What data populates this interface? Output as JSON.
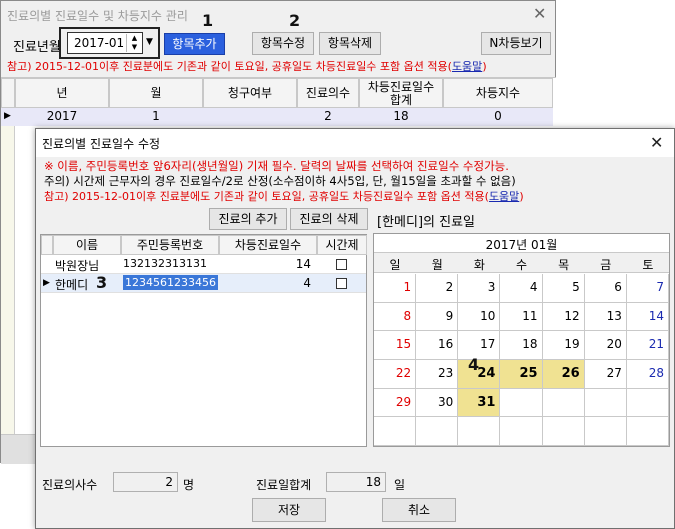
{
  "back_window": {
    "title": "진료의별 진료일수 및 차등지수 관리",
    "year_month_label": "진료년월",
    "year_month_value": "2017-01",
    "add_item_label": "항목추가",
    "edit_item_label": "항목수정",
    "delete_item_label": "항목삭제",
    "n_diff_view_label": "N차등보기",
    "notice_prefix": "참고) 2015-12-01이후 진료분에도 기존과 같이 토요일, 공휴일도 차등진료일수 포함 옵션 적용(",
    "notice_help": "도움말",
    "notice_suffix": ")",
    "columns": [
      "년",
      "월",
      "청구여부",
      "진료의수",
      "차등진료일수\n합계",
      "차등지수"
    ],
    "row": [
      "2017",
      "1",
      "",
      "2",
      "18",
      "0"
    ]
  },
  "callouts": [
    "1",
    "2",
    "3",
    "4"
  ],
  "dialog": {
    "title": "진료의별 진료일수 수정",
    "line1": "※ 이름, 주민등록번호 앞6자리(생년월일) 기재 필수. 달력의 날짜를 선택하여 진료일수 수정가능.",
    "line2": "주의) 시간제 근무자의 경우 진료일수/2로 산정(소수점이하 4사5입, 단, 월15일을 초과할 수 없음)",
    "notice_prefix": "참고) 2015-12-01이후 진료분에도 기존과 같이 토요일, 공휴일도 차등진료일수 포함 옵션 적용(",
    "notice_help": "도움말",
    "notice_suffix": ")",
    "add_doctor_label": "진료의 추가",
    "delete_doctor_label": "진료의 삭제",
    "selected_caption": "[한메디]의 진료일",
    "columns": [
      "이름",
      "주민등록번호",
      "차등진료일수",
      "시간제"
    ],
    "doctors": [
      {
        "name": "박원장님",
        "rrn": "132132313131",
        "days": "14"
      },
      {
        "name": "한메디",
        "rrn": "1234561233456",
        "days": "4"
      }
    ],
    "calendar": {
      "title": "2017년 01월",
      "weekdays": [
        "일",
        "월",
        "화",
        "수",
        "목",
        "금",
        "토"
      ],
      "weeks": [
        [
          "1",
          "2",
          "3",
          "4",
          "5",
          "6",
          "7"
        ],
        [
          "8",
          "9",
          "10",
          "11",
          "12",
          "13",
          "14"
        ],
        [
          "15",
          "16",
          "17",
          "18",
          "19",
          "20",
          "21"
        ],
        [
          "22",
          "23",
          "24",
          "25",
          "26",
          "27",
          "28"
        ],
        [
          "29",
          "30",
          "31",
          "",
          "",
          "",
          ""
        ],
        [
          "",
          "",
          "",
          "",
          "",
          "",
          ""
        ]
      ],
      "selected_days": [
        "24",
        "25",
        "26",
        "31"
      ],
      "sunday_color": "#e00000",
      "saturday_color": "#1a2ab0",
      "highlight_color": "#f0e292"
    },
    "doctor_count_label": "진료의사수",
    "doctor_count_value": "2",
    "doctor_count_unit": "명",
    "total_days_label": "진료일합계",
    "total_days_value": "18",
    "total_days_unit": "일",
    "save_label": "저장",
    "cancel_label": "취소"
  }
}
